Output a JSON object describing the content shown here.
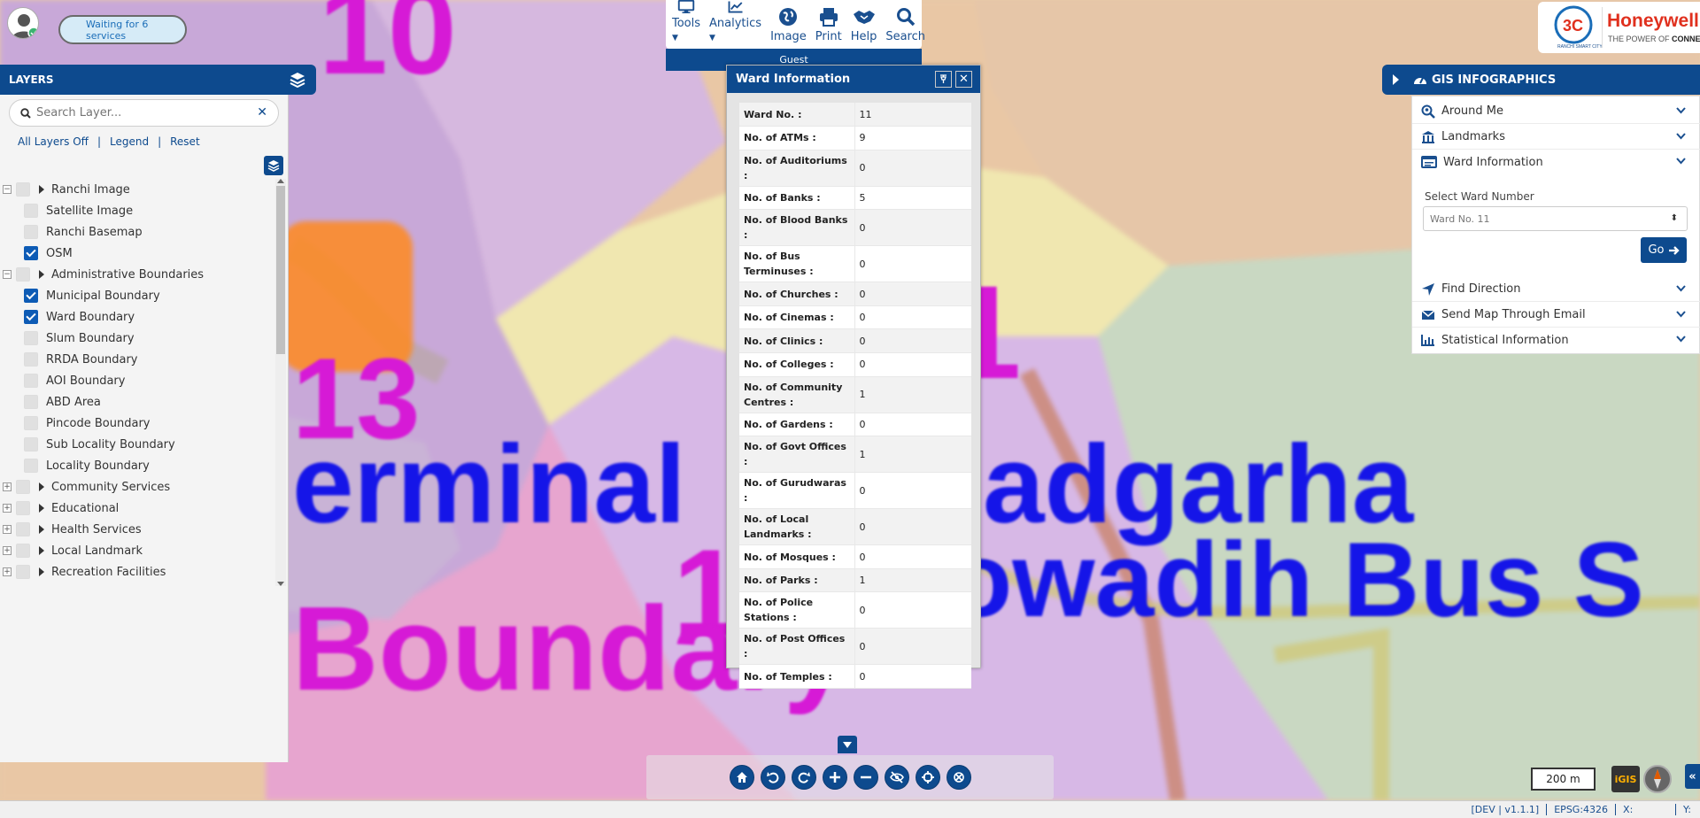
{
  "app": {
    "services_status": "Waiting for 6 services",
    "brand": {
      "name": "Honeywell",
      "tagline": "THE POWER OF CONNECTED",
      "partner": "RANCHI SMART CITY"
    }
  },
  "toolbar": {
    "items": [
      {
        "label": "Tools",
        "icon": "monitor-icon",
        "dropdown": true
      },
      {
        "label": "Analytics",
        "icon": "chart-line-icon",
        "dropdown": true
      },
      {
        "label": "Image",
        "icon": "globe-icon",
        "dropdown": false
      },
      {
        "label": "Print",
        "icon": "printer-icon",
        "dropdown": false
      },
      {
        "label": "Help",
        "icon": "handshake-icon",
        "dropdown": false
      },
      {
        "label": "Search",
        "icon": "search-icon",
        "dropdown": false
      }
    ],
    "user_label": "Guest"
  },
  "layers": {
    "title": "LAYERS",
    "search_placeholder": "Search Layer...",
    "links": {
      "all_off": "All Layers Off",
      "legend": "Legend",
      "reset": "Reset"
    },
    "rows": [
      {
        "label": "Ranchi Image",
        "group": true,
        "expanded": true,
        "checked": false
      },
      {
        "label": "Satellite Image",
        "group": false,
        "checked": false
      },
      {
        "label": "Ranchi Basemap",
        "group": false,
        "checked": false
      },
      {
        "label": "OSM",
        "group": false,
        "checked": true
      },
      {
        "label": "Administrative Boundaries",
        "group": true,
        "expanded": true,
        "checked": false
      },
      {
        "label": "Municipal Boundary",
        "group": false,
        "checked": true
      },
      {
        "label": "Ward Boundary",
        "group": false,
        "checked": true
      },
      {
        "label": "Slum Boundary",
        "group": false,
        "checked": false
      },
      {
        "label": "RRDA Boundary",
        "group": false,
        "checked": false
      },
      {
        "label": "AOI Boundary",
        "group": false,
        "checked": false
      },
      {
        "label": "ABD Area",
        "group": false,
        "checked": false
      },
      {
        "label": "Pincode Boundary",
        "group": false,
        "checked": false
      },
      {
        "label": "Sub Locality Boundary",
        "group": false,
        "checked": false
      },
      {
        "label": "Locality Boundary",
        "group": false,
        "checked": false
      },
      {
        "label": "Community Services",
        "group": true,
        "expanded": false,
        "checked": false
      },
      {
        "label": "Educational",
        "group": true,
        "expanded": false,
        "checked": false
      },
      {
        "label": "Health Services",
        "group": true,
        "expanded": false,
        "checked": false
      },
      {
        "label": "Local Landmark",
        "group": true,
        "expanded": false,
        "checked": false
      },
      {
        "label": "Recreation Facilities",
        "group": true,
        "expanded": false,
        "checked": false
      }
    ]
  },
  "ward_popup": {
    "title": "Ward Information",
    "rows": [
      {
        "key": "Ward No. :",
        "value": "11"
      },
      {
        "key": "No. of ATMs :",
        "value": "9"
      },
      {
        "key": "No. of Auditoriums :",
        "value": "0"
      },
      {
        "key": "No. of Banks :",
        "value": "5"
      },
      {
        "key": "No. of Blood Banks :",
        "value": "0"
      },
      {
        "key": "No. of Bus Terminuses :",
        "value": "0"
      },
      {
        "key": "No. of Churches :",
        "value": "0"
      },
      {
        "key": "No. of Cinemas :",
        "value": "0"
      },
      {
        "key": "No. of Clinics :",
        "value": "0"
      },
      {
        "key": "No. of Colleges :",
        "value": "0"
      },
      {
        "key": "No. of Community Centres :",
        "value": "1"
      },
      {
        "key": "No. of Gardens :",
        "value": "0"
      },
      {
        "key": "No. of Govt Offices :",
        "value": "1"
      },
      {
        "key": "No. of Gurudwaras :",
        "value": "0"
      },
      {
        "key": "No. of Local Landmarks :",
        "value": "0"
      },
      {
        "key": "No. of Mosques :",
        "value": "0"
      },
      {
        "key": "No. of Parks :",
        "value": "1"
      },
      {
        "key": "No. of Police Stations :",
        "value": "0"
      },
      {
        "key": "No. of Post Offices :",
        "value": "0"
      },
      {
        "key": "No. of Temples :",
        "value": "0"
      }
    ]
  },
  "gis": {
    "title": "GIS INFOGRAPHICS",
    "sections": [
      {
        "label": "Around Me",
        "icon": "search-location-icon"
      },
      {
        "label": "Landmarks",
        "icon": "landmark-icon"
      },
      {
        "label": "Ward Information",
        "icon": "id-card-icon"
      }
    ],
    "select_label": "Select Ward Number",
    "select_value": "Ward No. 11",
    "go_label": "Go",
    "sections_after": [
      {
        "label": "Find Direction",
        "icon": "location-arrow-icon"
      },
      {
        "label": "Send Map Through Email",
        "icon": "envelope-icon"
      },
      {
        "label": "Statistical Information",
        "icon": "bar-chart-icon"
      }
    ]
  },
  "map": {
    "labels": [
      "10",
      "13",
      "erminal",
      "adgarha",
      "owadih Bus S",
      "Boundary",
      "1",
      "1"
    ],
    "scale": "200 m",
    "logo_badge": "iGIS"
  },
  "status": {
    "version": "[DEV | v1.1.1]",
    "epsg": "EPSG:4326",
    "x_label": "X:",
    "y_label": "Y:"
  },
  "colors": {
    "primary": "#0d4a8e",
    "checkbox_on": "#0d5bb5",
    "map_label_blue": "#1515e8",
    "map_label_magenta": "#d61ad6"
  }
}
